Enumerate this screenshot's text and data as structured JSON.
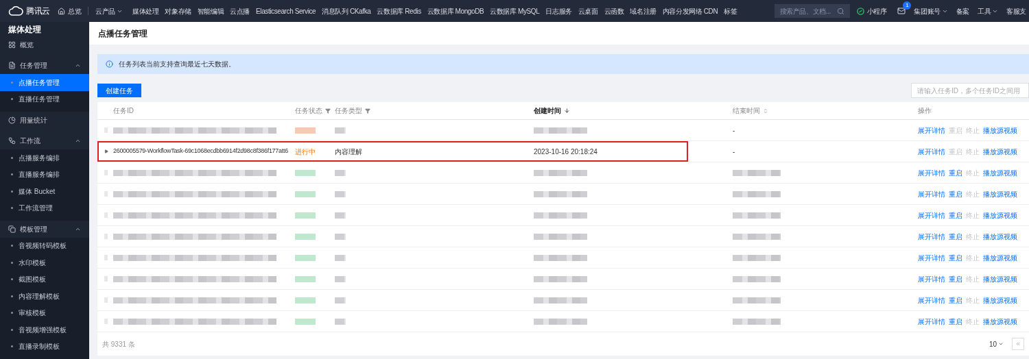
{
  "topbar": {
    "brand": "腾讯云",
    "home": "总览",
    "products": "云产品",
    "nav": [
      "媒体处理",
      "对象存储",
      "智能编辑",
      "云点播",
      "Elasticsearch Service",
      "消息队列 CKafka",
      "云数据库 Redis",
      "云数据库 MongoDB",
      "云数据库 MySQL",
      "日志服务",
      "云桌面",
      "云函数",
      "域名注册",
      "内容分发网络 CDN",
      "标签"
    ],
    "search": {
      "placeholder": "搜索产品、文档..."
    },
    "mini_program": "小程序",
    "mail_badge": "1",
    "account": "集团账号",
    "filing": "备案",
    "tools": "工具",
    "support": "客服支"
  },
  "sidebar": {
    "title": "媒体处理",
    "items": [
      {
        "label": "概览",
        "selected": false
      },
      {
        "label": "任务管理",
        "expanded": true,
        "selected": false,
        "children": [
          {
            "label": "点播任务管理",
            "selected": true
          },
          {
            "label": "直播任务管理",
            "selected": false
          }
        ]
      },
      {
        "label": "用量统计",
        "selected": false
      },
      {
        "label": "工作流",
        "expanded": true,
        "selected": false,
        "children": [
          {
            "label": "点播服务编排",
            "selected": false
          },
          {
            "label": "直播服务编排",
            "selected": false
          },
          {
            "label": "媒体 Bucket",
            "selected": false
          },
          {
            "label": "工作流管理",
            "selected": false
          }
        ]
      },
      {
        "label": "模板管理",
        "expanded": true,
        "selected": false,
        "children": [
          {
            "label": "音视频转码模板",
            "selected": false
          },
          {
            "label": "水印模板",
            "selected": false
          },
          {
            "label": "截图模板",
            "selected": false
          },
          {
            "label": "内容理解模板",
            "selected": false
          },
          {
            "label": "审核模板",
            "selected": false
          },
          {
            "label": "音视频增强模板",
            "selected": false
          },
          {
            "label": "直播录制模板",
            "selected": false
          }
        ]
      }
    ]
  },
  "page_title": "点播任务管理",
  "notice": "任务列表当前支持查询最近七天数据。",
  "create_button": "创建任务",
  "filter": {
    "placeholder": "请输入任务ID，多个任务ID之间用"
  },
  "table": {
    "columns": [
      {
        "label": "任务ID",
        "kind": "plain",
        "bold": false
      },
      {
        "label": "任务状态",
        "kind": "filter",
        "bold": false
      },
      {
        "label": "任务类型",
        "kind": "filter",
        "bold": false
      },
      {
        "label": "创建时间",
        "kind": "sorted",
        "bold": true
      },
      {
        "label": "结束时间",
        "kind": "sortable",
        "bold": false
      },
      {
        "label": "操作",
        "kind": "plain",
        "bold": false
      }
    ],
    "rows": [
      {
        "kind": "blurred",
        "color": "#f9c9b3",
        "end_time": "-",
        "highlighted": false,
        "actions": [
          {
            "label": "展开详情",
            "disabled": false
          },
          {
            "label": "重启",
            "disabled": true
          },
          {
            "label": "终止",
            "disabled": true
          },
          {
            "label": "播放源视频",
            "disabled": false
          }
        ]
      },
      {
        "kind": "text",
        "task_id": "2600005579-WorkflowTask-69c1068ecdbb6914f2d98c8f386f177att6",
        "status": "进行中",
        "task_type": "内容理解",
        "created": "2023-10-16 20:18:24",
        "end_time": "-",
        "highlighted": true,
        "actions": [
          {
            "label": "展开详情",
            "disabled": false
          },
          {
            "label": "重启",
            "disabled": true
          },
          {
            "label": "终止",
            "disabled": true
          },
          {
            "label": "播放源视频",
            "disabled": false
          }
        ]
      },
      {
        "kind": "blurred",
        "color": "#bfe8cf",
        "highlighted": false,
        "actions": [
          {
            "label": "展开详情",
            "disabled": false
          },
          {
            "label": "重启",
            "disabled": false
          },
          {
            "label": "终止",
            "disabled": true
          },
          {
            "label": "播放源视频",
            "disabled": false
          }
        ]
      },
      {
        "kind": "blurred",
        "color": "#bfe8cf",
        "highlighted": false,
        "actions": [
          {
            "label": "展开详情",
            "disabled": false
          },
          {
            "label": "重启",
            "disabled": false
          },
          {
            "label": "终止",
            "disabled": true
          },
          {
            "label": "播放源视频",
            "disabled": false
          }
        ]
      },
      {
        "kind": "blurred",
        "color": "#bfe8cf",
        "highlighted": false,
        "actions": [
          {
            "label": "展开详情",
            "disabled": false
          },
          {
            "label": "重启",
            "disabled": false
          },
          {
            "label": "终止",
            "disabled": true
          },
          {
            "label": "播放源视频",
            "disabled": false
          }
        ]
      },
      {
        "kind": "blurred",
        "color": "#bfe8cf",
        "highlighted": false,
        "actions": [
          {
            "label": "展开详情",
            "disabled": false
          },
          {
            "label": "重启",
            "disabled": false
          },
          {
            "label": "终止",
            "disabled": true
          },
          {
            "label": "播放源视频",
            "disabled": false
          }
        ]
      },
      {
        "kind": "blurred",
        "color": "#bfe8cf",
        "highlighted": false,
        "actions": [
          {
            "label": "展开详情",
            "disabled": false
          },
          {
            "label": "重启",
            "disabled": false
          },
          {
            "label": "终止",
            "disabled": true
          },
          {
            "label": "播放源视频",
            "disabled": false
          }
        ]
      },
      {
        "kind": "blurred",
        "color": "#bfe8cf",
        "highlighted": false,
        "actions": [
          {
            "label": "展开详情",
            "disabled": false
          },
          {
            "label": "重启",
            "disabled": false
          },
          {
            "label": "终止",
            "disabled": true
          },
          {
            "label": "播放源视频",
            "disabled": false
          }
        ]
      },
      {
        "kind": "blurred",
        "color": "#bfe8cf",
        "highlighted": false,
        "actions": [
          {
            "label": "展开详情",
            "disabled": false
          },
          {
            "label": "重启",
            "disabled": false
          },
          {
            "label": "终止",
            "disabled": true
          },
          {
            "label": "播放源视频",
            "disabled": false
          }
        ]
      },
      {
        "kind": "blurred",
        "color": "#bfe8cf",
        "highlighted": false,
        "actions": [
          {
            "label": "展开详情",
            "disabled": false
          },
          {
            "label": "重启",
            "disabled": false
          },
          {
            "label": "终止",
            "disabled": true
          },
          {
            "label": "播放源视频",
            "disabled": false
          }
        ]
      }
    ],
    "total": "共 9331 条",
    "page_size": "10"
  }
}
